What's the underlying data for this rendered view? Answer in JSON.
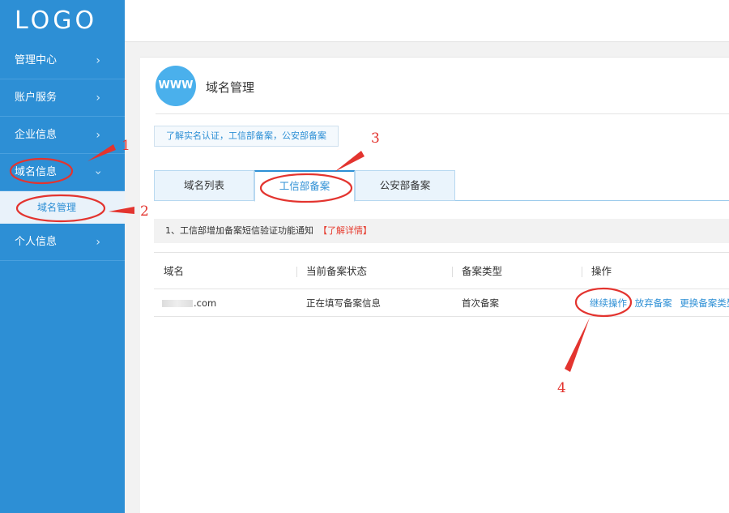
{
  "logo": "LOGO",
  "sidebar": {
    "items": [
      {
        "label": "管理中心"
      },
      {
        "label": "账户服务"
      },
      {
        "label": "企业信息"
      },
      {
        "label": "域名信息"
      },
      {
        "label": "个人信息"
      }
    ],
    "sub_item": "域名管理"
  },
  "header": {
    "icon_text": "WWW",
    "title": "域名管理"
  },
  "info_link": "了解实名认证，工信部备案，公安部备案",
  "tabs": [
    {
      "label": "域名列表"
    },
    {
      "label": "工信部备案"
    },
    {
      "label": "公安部备案"
    }
  ],
  "notice": {
    "text": "1、工信部增加备案短信验证功能通知",
    "more": "【了解详情】"
  },
  "table": {
    "columns": [
      "域名",
      "当前备案状态",
      "备案类型",
      "操作"
    ],
    "rows": [
      {
        "domain_suffix": ".com",
        "status": "正在填写备案信息",
        "type": "首次备案",
        "actions": [
          "继续操作",
          "放弃备案",
          "更换备案类型"
        ]
      }
    ]
  },
  "annotations": [
    "1",
    "2",
    "3",
    "4"
  ],
  "colors": {
    "sidebar": "#2d8fd5",
    "accent": "#2d8fd5",
    "annotation": "#e3342f"
  }
}
